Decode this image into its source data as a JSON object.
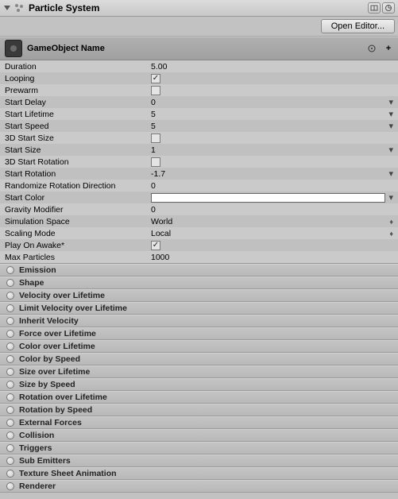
{
  "header": {
    "title": "Particle System",
    "open_editor_label": "Open Editor..."
  },
  "main_module": {
    "name": "GameObject Name"
  },
  "props": {
    "duration": {
      "label": "Duration",
      "value": "5.00"
    },
    "looping": {
      "label": "Looping",
      "checked": true
    },
    "prewarm": {
      "label": "Prewarm",
      "checked": false
    },
    "start_delay": {
      "label": "Start Delay",
      "value": "0"
    },
    "start_lifetime": {
      "label": "Start Lifetime",
      "value": "5"
    },
    "start_speed": {
      "label": "Start Speed",
      "value": "5"
    },
    "start_size_3d": {
      "label": "3D Start Size",
      "checked": false
    },
    "start_size": {
      "label": "Start Size",
      "value": "1"
    },
    "start_rotation_3d": {
      "label": "3D Start Rotation",
      "checked": false
    },
    "start_rotation": {
      "label": "Start Rotation",
      "value": "-1.7"
    },
    "randomize_rotation": {
      "label": "Randomize Rotation Direction",
      "value": "0"
    },
    "start_color": {
      "label": "Start Color",
      "value": "#ffffff"
    },
    "gravity_modifier": {
      "label": "Gravity Modifier",
      "value": "0"
    },
    "simulation_space": {
      "label": "Simulation Space",
      "value": "World"
    },
    "scaling_mode": {
      "label": "Scaling Mode",
      "value": "Local"
    },
    "play_on_awake": {
      "label": "Play On Awake*",
      "checked": true
    },
    "max_particles": {
      "label": "Max Particles",
      "value": "1000"
    }
  },
  "modules": [
    {
      "label": "Emission"
    },
    {
      "label": "Shape"
    },
    {
      "label": "Velocity over Lifetime"
    },
    {
      "label": "Limit Velocity over Lifetime"
    },
    {
      "label": "Inherit Velocity"
    },
    {
      "label": "Force over Lifetime"
    },
    {
      "label": "Color over Lifetime"
    },
    {
      "label": "Color by Speed"
    },
    {
      "label": "Size over Lifetime"
    },
    {
      "label": "Size by Speed"
    },
    {
      "label": "Rotation over Lifetime"
    },
    {
      "label": "Rotation by Speed"
    },
    {
      "label": "External Forces"
    },
    {
      "label": "Collision"
    },
    {
      "label": "Triggers"
    },
    {
      "label": "Sub Emitters"
    },
    {
      "label": "Texture Sheet Animation"
    },
    {
      "label": "Renderer"
    }
  ]
}
